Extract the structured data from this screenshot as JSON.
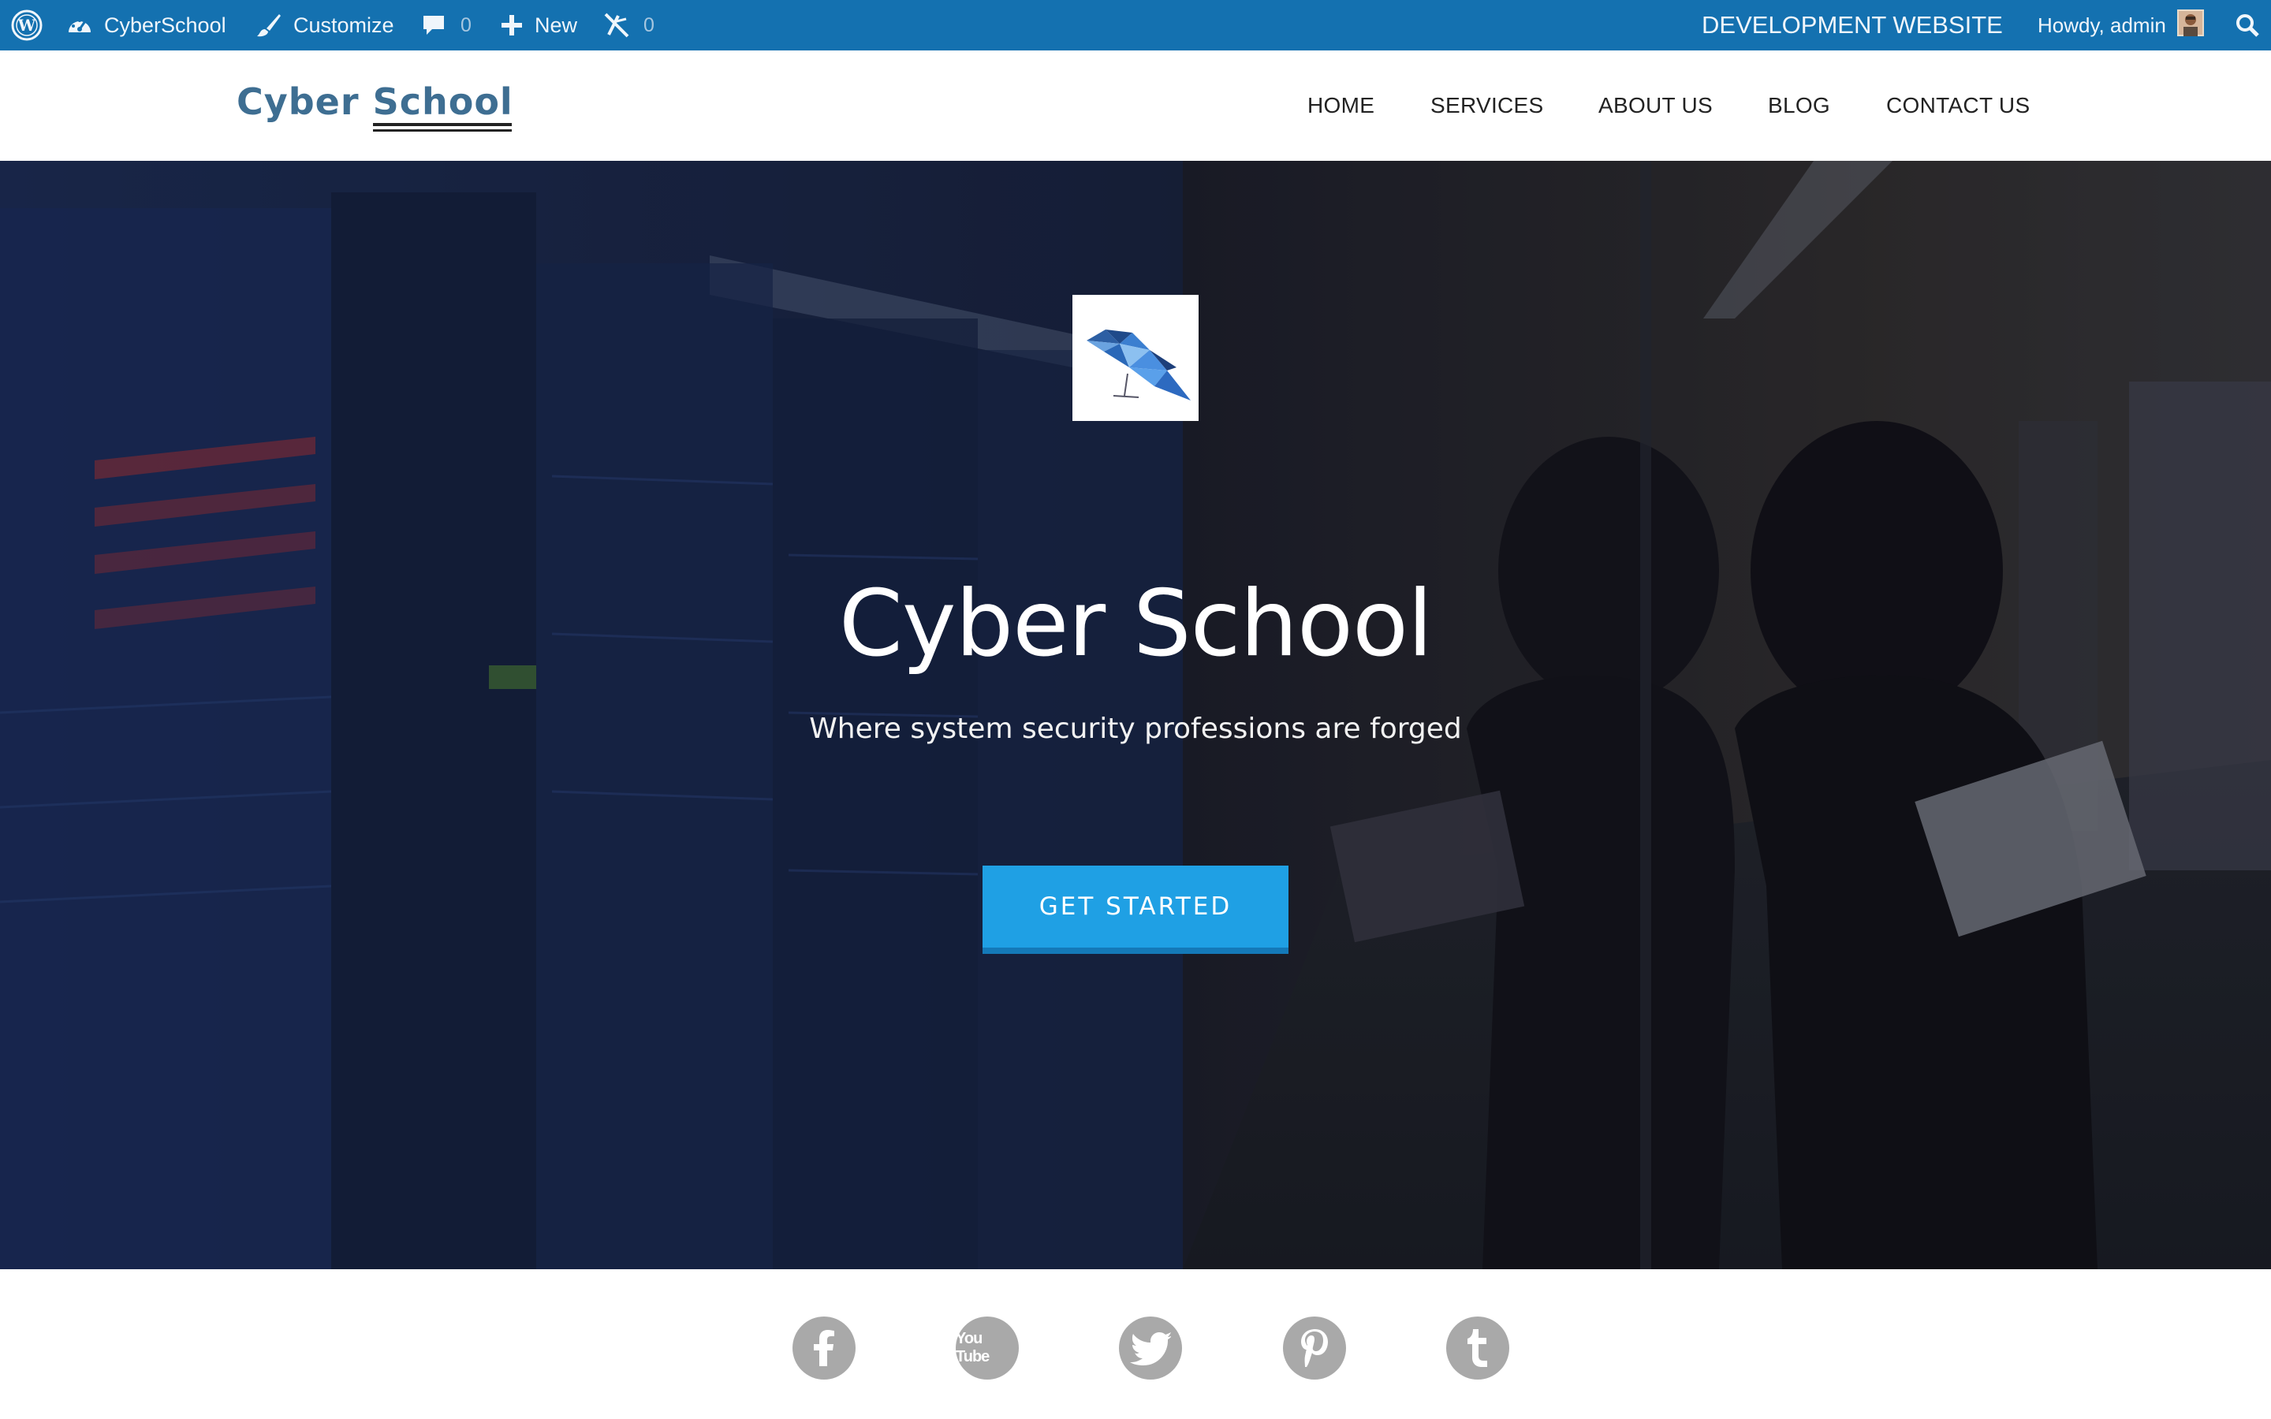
{
  "admin_bar": {
    "site_name": "CyberSchool",
    "customize_label": "Customize",
    "comments_count": "0",
    "new_label": "New",
    "updates_count": "0",
    "environment_label": "DEVELOPMENT WEBSITE",
    "greeting": "Howdy, admin"
  },
  "header": {
    "logo_word1": "Cyber",
    "logo_word2": "School",
    "nav": [
      {
        "label": "HOME"
      },
      {
        "label": "SERVICES"
      },
      {
        "label": "ABOUT US"
      },
      {
        "label": "BLOG"
      },
      {
        "label": "CONTACT US"
      }
    ]
  },
  "hero": {
    "title": "Cyber School",
    "subtitle": "Where system security professions are forged",
    "cta_label": "GET STARTED"
  },
  "social": {
    "icons": [
      "facebook-icon",
      "youtube-icon",
      "twitter-icon",
      "pinterest-icon",
      "tumblr-icon"
    ],
    "youtube_text": "You Tube"
  },
  "colors": {
    "admin_bar": "#1471b0",
    "cta": "#1fa0e4",
    "social_icon": "#a9a9a9",
    "logo": "#3e6e92"
  }
}
